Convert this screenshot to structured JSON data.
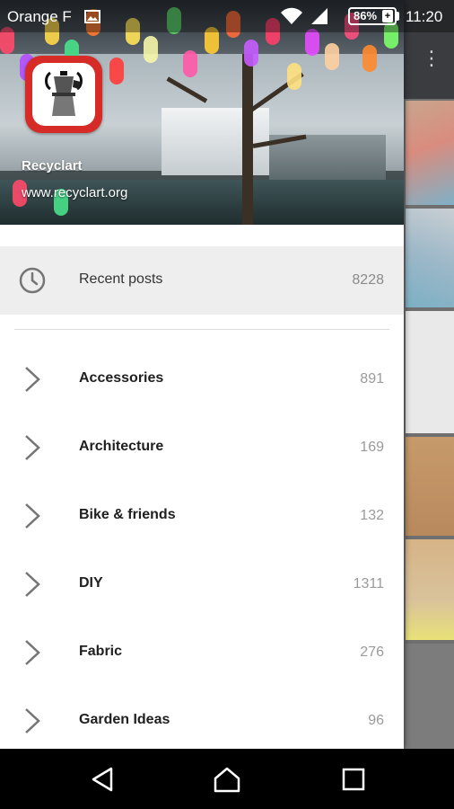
{
  "status_bar": {
    "carrier": "Orange F",
    "battery": "86%",
    "time": "11:20"
  },
  "header": {
    "name": "Recyclart",
    "url": "www.recyclart.org"
  },
  "recent": {
    "label": "Recent posts",
    "count": "8228"
  },
  "categories": [
    {
      "label": "Accessories",
      "count": "891"
    },
    {
      "label": "Architecture",
      "count": "169"
    },
    {
      "label": "Bike & friends",
      "count": "132"
    },
    {
      "label": "DIY",
      "count": "1311"
    },
    {
      "label": "Fabric",
      "count": "276"
    },
    {
      "label": "Garden Ideas",
      "count": "96"
    }
  ],
  "colors": {
    "brand_red": "#d62b26",
    "selected_row": "#eeeeee",
    "count_gray": "#9a9a9a"
  }
}
